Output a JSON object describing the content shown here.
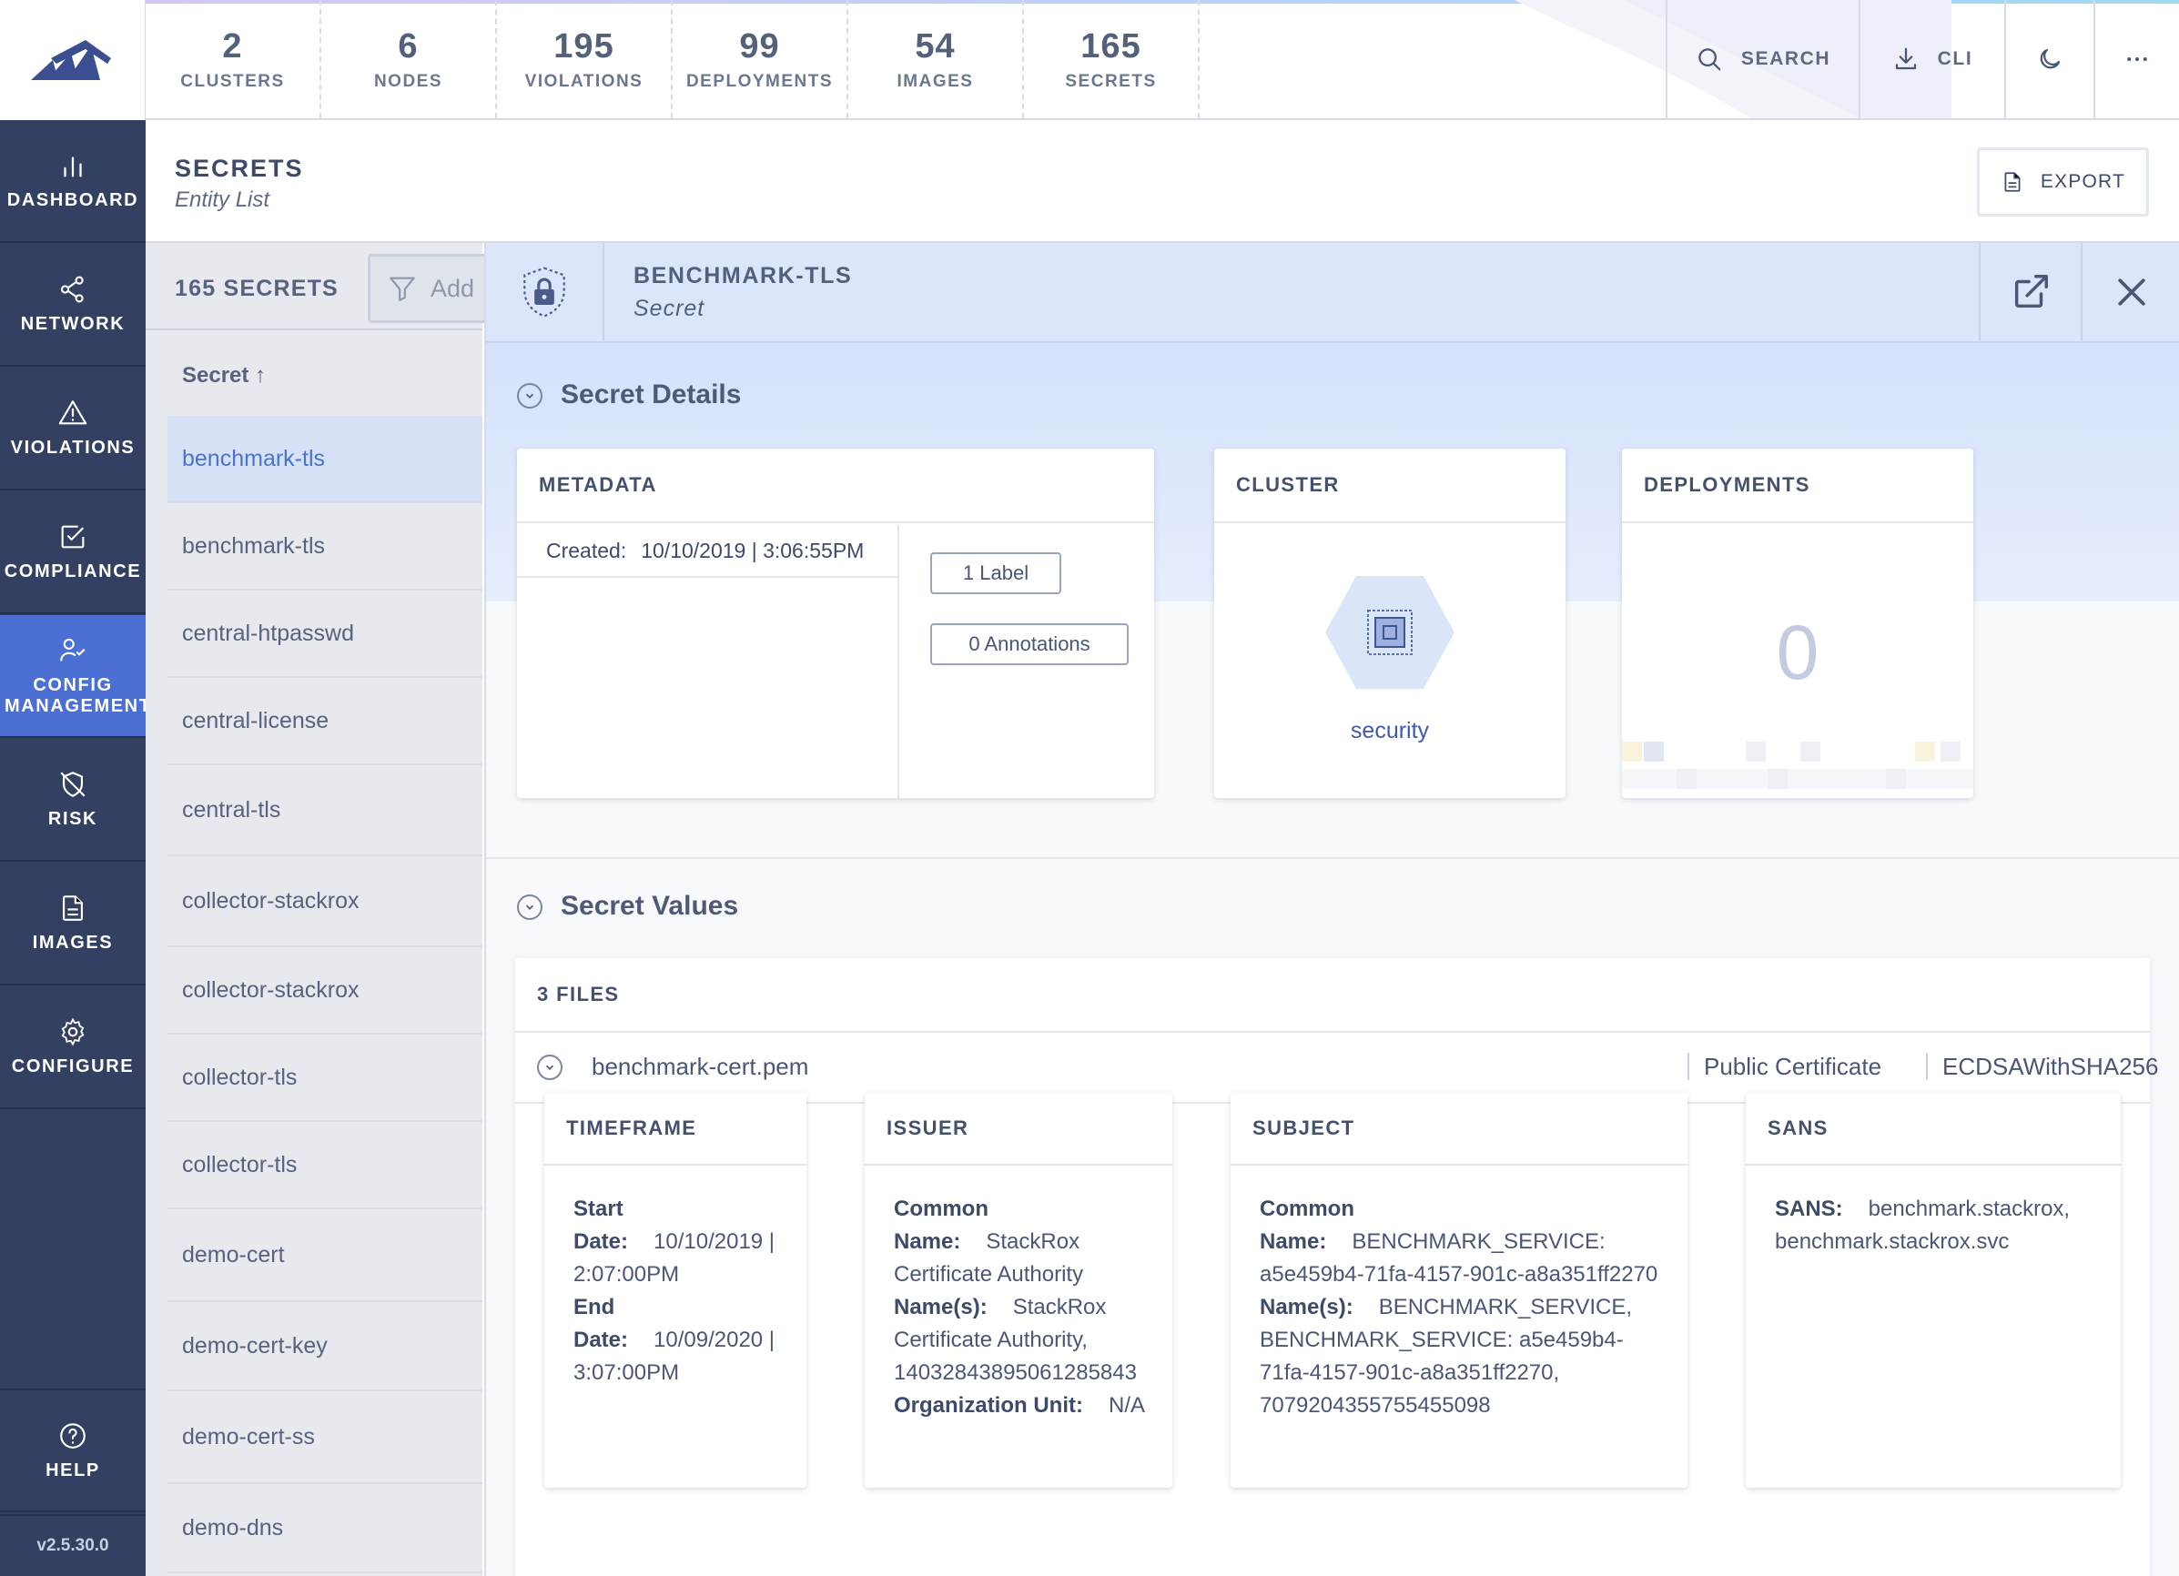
{
  "topbar": {
    "stats": [
      {
        "value": "2",
        "label": "CLUSTERS"
      },
      {
        "value": "6",
        "label": "NODES"
      },
      {
        "value": "195",
        "label": "VIOLATIONS"
      },
      {
        "value": "99",
        "label": "DEPLOYMENTS"
      },
      {
        "value": "54",
        "label": "IMAGES"
      },
      {
        "value": "165",
        "label": "SECRETS"
      }
    ],
    "search_label": "SEARCH",
    "cli_label": "CLI"
  },
  "sidebar": {
    "items": [
      {
        "label": "DASHBOARD",
        "icon": "bar-chart-icon"
      },
      {
        "label": "NETWORK",
        "icon": "share-icon"
      },
      {
        "label": "VIOLATIONS",
        "icon": "warning-icon"
      },
      {
        "label": "COMPLIANCE",
        "icon": "check-square-icon"
      },
      {
        "label": "CONFIG MANAGEMENT",
        "icon": "user-check-icon",
        "active": true
      },
      {
        "label": "RISK",
        "icon": "shield-off-icon"
      },
      {
        "label": "IMAGES",
        "icon": "file-icon"
      },
      {
        "label": "CONFIGURE",
        "icon": "gear-icon"
      }
    ],
    "help_label": "HELP",
    "version": "v2.5.30.0"
  },
  "header": {
    "title": "SECRETS",
    "subtitle": "Entity List",
    "export_label": "EXPORT"
  },
  "list": {
    "count_label": "165 SECRETS",
    "filter_placeholder": "Add",
    "column_header": "Secret ↑",
    "rows": [
      "benchmark-tls",
      "benchmark-tls",
      "central-htpasswd",
      "central-license",
      "central-tls",
      "collector-stackrox",
      "collector-stackrox",
      "collector-tls",
      "collector-tls",
      "demo-cert",
      "demo-cert-key",
      "demo-cert-ss",
      "demo-dns"
    ]
  },
  "detail": {
    "title": "BENCHMARK-TLS",
    "subtitle": "Secret",
    "secret_details_title": "Secret Details",
    "metadata": {
      "header": "METADATA",
      "created_label": "Created:",
      "created_value": "10/10/2019 | 3:06:55PM",
      "labels_chip": "1 Label",
      "annotations_chip": "0 Annotations"
    },
    "cluster": {
      "header": "CLUSTER",
      "name": "security"
    },
    "deployments": {
      "header": "DEPLOYMENTS",
      "count": "0"
    },
    "secret_values_title": "Secret Values",
    "files": {
      "header": "3 FILES",
      "file_name": "benchmark-cert.pem",
      "file_type": "Public Certificate",
      "algorithm": "ECDSAWithSHA256",
      "timeframe": {
        "header": "TIMEFRAME",
        "start_label": "Start Date:",
        "start_value": "10/10/2019 | 2:07:00PM",
        "end_label": "End Date:",
        "end_value": "10/09/2020 | 3:07:00PM"
      },
      "issuer": {
        "header": "ISSUER",
        "common_name_label": "Common Name:",
        "common_name_value": "StackRox Certificate Authority",
        "names_label": "Name(s):",
        "names_value": "StackRox Certificate Authority, 14032843895061285843",
        "org_unit_label": "Organization Unit:",
        "org_unit_value": "N/A"
      },
      "subject": {
        "header": "SUBJECT",
        "common_name_label": "Common Name:",
        "common_name_value": "BENCHMARK_SERVICE: a5e459b4-71fa-4157-901c-a8a351ff2270",
        "names_label": "Name(s):",
        "names_value": "BENCHMARK_SERVICE, BENCHMARK_SERVICE: a5e459b4-71fa-4157-901c-a8a351ff2270, 7079204355755455098"
      },
      "sans": {
        "header": "SANS",
        "label": "SANS:",
        "value": "benchmark.stackrox, benchmark.stackrox.svc"
      }
    }
  },
  "colors": {
    "sidebar": "#344062",
    "active_nav": "#4b6fd3",
    "accent_link": "#4a74cc",
    "detail_header": "#dbe6fb"
  }
}
